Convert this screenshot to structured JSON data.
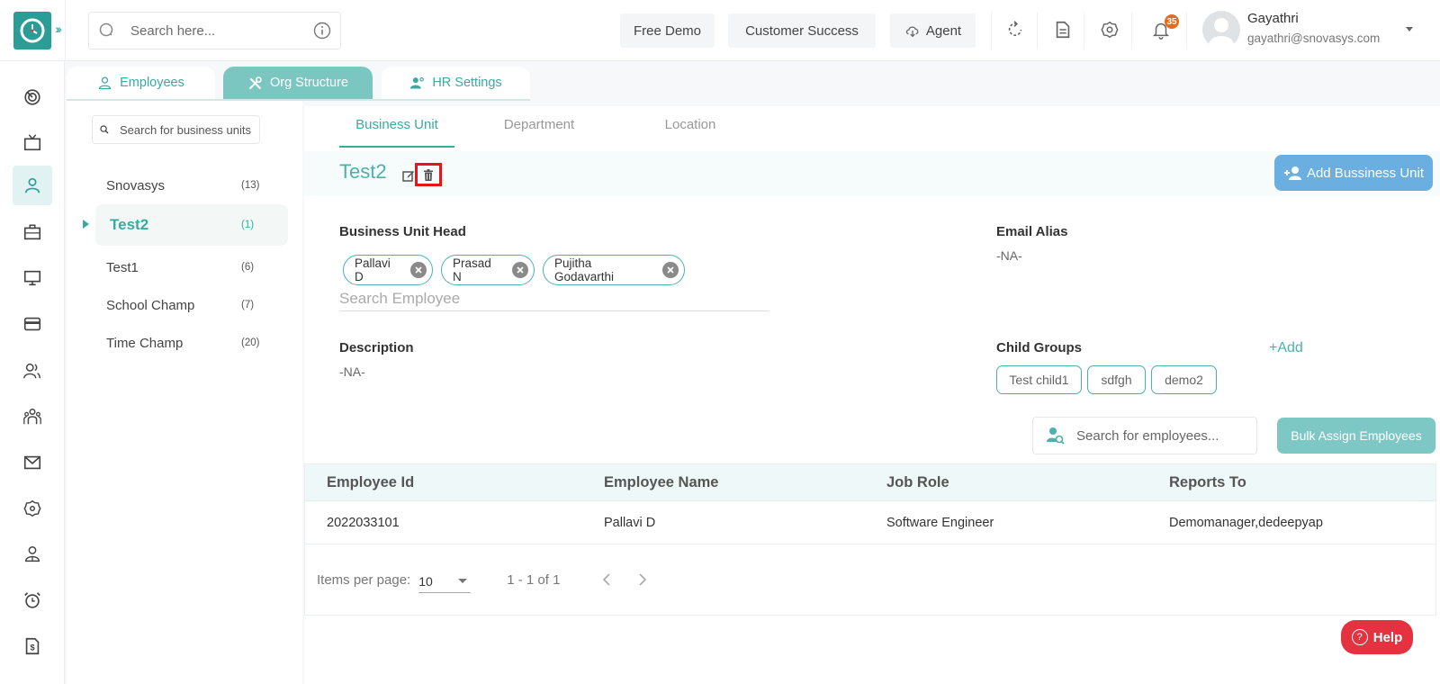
{
  "header": {
    "search_placeholder": "Search here...",
    "buttons": {
      "free_demo": "Free Demo",
      "customer_success": "Customer Success",
      "agent": "Agent"
    },
    "notification_count": "35",
    "user": {
      "name": "Gayathri",
      "email": "gayathri@snovasys.com"
    }
  },
  "leftnav": {
    "items": [
      {
        "icon": "dashboard-icon",
        "active": false
      },
      {
        "icon": "tv-icon",
        "active": false
      },
      {
        "icon": "user-icon",
        "active": true
      },
      {
        "icon": "briefcase-icon",
        "active": false
      },
      {
        "icon": "monitor-icon",
        "active": false
      },
      {
        "icon": "card-icon",
        "active": false
      },
      {
        "icon": "users-icon",
        "active": false
      },
      {
        "icon": "team-icon",
        "active": false
      },
      {
        "icon": "mail-icon",
        "active": false
      },
      {
        "icon": "settings-icon",
        "active": false
      },
      {
        "icon": "employee-icon",
        "active": false
      },
      {
        "icon": "alarm-icon",
        "active": false
      },
      {
        "icon": "invoice-icon",
        "active": false
      }
    ]
  },
  "main_tabs": [
    {
      "label": "Employees",
      "active": false
    },
    {
      "label": "Org Structure",
      "active": true
    },
    {
      "label": "HR Settings",
      "active": false
    }
  ],
  "bu_panel": {
    "search_placeholder": "Search for business units",
    "items": [
      {
        "name": "Snovasys",
        "count": "(13)",
        "active": false
      },
      {
        "name": "Test2",
        "count": "(1)",
        "active": true
      },
      {
        "name": "Test1",
        "count": "(6)",
        "active": false
      },
      {
        "name": "School Champ",
        "count": "(7)",
        "active": false
      },
      {
        "name": "Time Champ",
        "count": "(20)",
        "active": false
      }
    ]
  },
  "sub_tabs": [
    {
      "label": "Business Unit",
      "active": true
    },
    {
      "label": "Department",
      "active": false
    },
    {
      "label": "Location",
      "active": false
    }
  ],
  "unit": {
    "title": "Test2",
    "add_button": "Add Bussiness Unit",
    "head_label": "Business Unit Head",
    "heads": [
      "Pallavi D",
      "Prasad N",
      "Pujitha Godavarthi"
    ],
    "employee_search_placeholder": "Search Employee",
    "email_alias_label": "Email Alias",
    "email_alias_value": "-NA-",
    "description_label": "Description",
    "description_value": "-NA-",
    "child_groups_label": "Child Groups",
    "child_groups_add": "+Add",
    "child_groups": [
      "Test child1",
      "sdfgh",
      "demo2"
    ]
  },
  "employees": {
    "search_placeholder": "Search for employees...",
    "bulk_button": "Bulk Assign Employees",
    "columns": [
      "Employee Id",
      "Employee Name",
      "Job Role",
      "Reports To"
    ],
    "rows": [
      [
        "2022033101",
        "Pallavi D",
        "Software Engineer",
        "Demomanager,dedeepyap"
      ]
    ],
    "paginator": {
      "items_per_page_label": "Items per page:",
      "items_per_page": "10",
      "range": "1 - 1 of 1"
    }
  },
  "help": {
    "label": "Help"
  },
  "colors": {
    "brand": "#2a9d96",
    "accent": "#4ab2ab",
    "add_button": "#6aafdf",
    "bulk_button": "#7dc8c4",
    "help_button": "#e53241",
    "highlight_box": "#e8131b",
    "badge": "#e36b1e"
  }
}
